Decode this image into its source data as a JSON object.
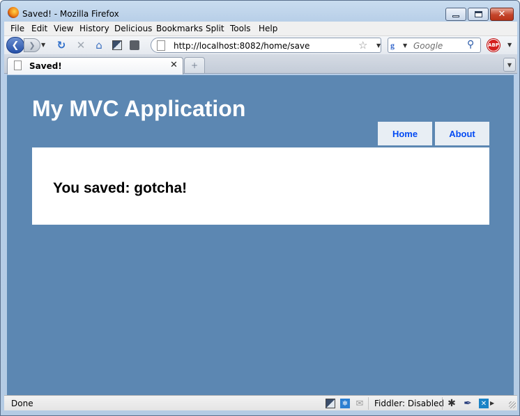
{
  "window": {
    "title": "Saved! - Mozilla Firefox"
  },
  "menubar": {
    "items": [
      "File",
      "Edit",
      "View",
      "History",
      "Delicious",
      "Bookmarks",
      "Split",
      "Tools",
      "Help"
    ]
  },
  "navbar": {
    "url": "http://localhost:8082/home/save",
    "search_placeholder": "Google",
    "abp_label": "ABP"
  },
  "tabs": [
    {
      "label": "Saved!",
      "active": true
    }
  ],
  "page": {
    "site_title": "My MVC Application",
    "menu": [
      "Home",
      "About"
    ],
    "heading": "You saved: gotcha!",
    "background_color": "#5c87b2",
    "link_color": "#034af3"
  },
  "statusbar": {
    "status": "Done",
    "fiddler": "Fiddler: Disabled"
  }
}
